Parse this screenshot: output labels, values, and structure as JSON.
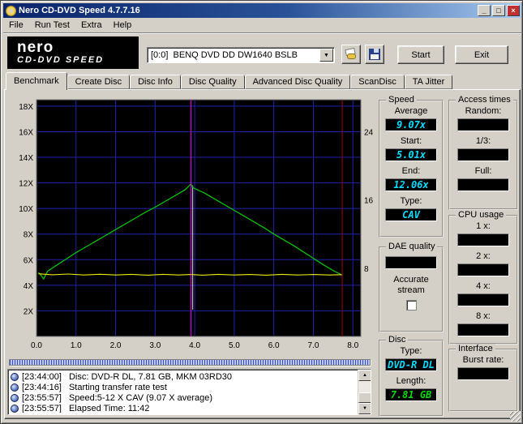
{
  "window": {
    "title": "Nero CD-DVD Speed 4.7.7.16",
    "menu": [
      "File",
      "Run Test",
      "Extra",
      "Help"
    ]
  },
  "icons": {
    "minimize": "_",
    "maximize": "□",
    "close": "×",
    "dropdown": "▼",
    "scroll_up": "▲",
    "scroll_down": "▼"
  },
  "toolbar": {
    "logo_brand": "nero",
    "logo_product": "CD-DVD SPEED",
    "drive_selector": "[0:0]  BENQ DVD DD DW1640 BSLB",
    "start_label": "Start",
    "exit_label": "Exit"
  },
  "tabs": [
    {
      "label": "Benchmark",
      "active": true
    },
    {
      "label": "Create Disc"
    },
    {
      "label": "Disc Info"
    },
    {
      "label": "Disc Quality"
    },
    {
      "label": "Advanced Disc Quality"
    },
    {
      "label": "ScanDisc"
    },
    {
      "label": "TA Jitter"
    }
  ],
  "chart_data": {
    "type": "line",
    "title": "",
    "xlabel": "",
    "ylabel": "",
    "xlim": [
      0,
      8.2
    ],
    "ylim": [
      0,
      18.5
    ],
    "x_ticks": [
      0,
      1,
      2,
      3,
      4,
      5,
      6,
      7,
      8
    ],
    "x_tick_labels": [
      "0.0",
      "1.0",
      "2.0",
      "3.0",
      "4.0",
      "5.0",
      "6.0",
      "7.0",
      "8.0"
    ],
    "y_ticks": [
      2,
      4,
      6,
      8,
      10,
      12,
      14,
      16,
      18
    ],
    "y_tick_labels": [
      "2X",
      "4X",
      "6X",
      "8X",
      "10X",
      "12X",
      "14X",
      "16X",
      "18X"
    ],
    "right_axis": {
      "ticks": [
        8,
        16,
        24
      ],
      "ratio": 1.5
    },
    "grid": true,
    "grid_color": "#2121a8",
    "plot_bg": "#000000",
    "series": [
      {
        "name": "read-speed",
        "color": "#00c000",
        "width": 1.3,
        "points": [
          [
            0.05,
            5.0
          ],
          [
            0.12,
            4.75
          ],
          [
            0.18,
            4.5
          ],
          [
            0.28,
            5.1
          ],
          [
            0.5,
            5.55
          ],
          [
            0.75,
            6.05
          ],
          [
            1.0,
            6.55
          ],
          [
            1.25,
            7.0
          ],
          [
            1.5,
            7.45
          ],
          [
            1.75,
            7.9
          ],
          [
            2.0,
            8.35
          ],
          [
            2.25,
            8.8
          ],
          [
            2.5,
            9.25
          ],
          [
            2.75,
            9.7
          ],
          [
            3.0,
            10.1
          ],
          [
            3.25,
            10.55
          ],
          [
            3.5,
            11.0
          ],
          [
            3.75,
            11.45
          ],
          [
            3.9,
            11.9
          ],
          [
            3.97,
            11.6
          ],
          [
            4.25,
            11.2
          ],
          [
            4.5,
            10.75
          ],
          [
            4.75,
            10.3
          ],
          [
            5.0,
            9.85
          ],
          [
            5.25,
            9.4
          ],
          [
            5.5,
            8.95
          ],
          [
            5.75,
            8.5
          ],
          [
            6.0,
            8.0
          ],
          [
            6.25,
            7.55
          ],
          [
            6.5,
            7.1
          ],
          [
            6.75,
            6.6
          ],
          [
            7.0,
            6.1
          ],
          [
            7.25,
            5.6
          ],
          [
            7.5,
            5.15
          ],
          [
            7.72,
            4.8
          ]
        ]
      },
      {
        "name": "rotation-speed",
        "color": "#e8e800",
        "width": 1.1,
        "points": [
          [
            0.05,
            4.9
          ],
          [
            0.4,
            4.82
          ],
          [
            0.8,
            4.88
          ],
          [
            1.2,
            4.8
          ],
          [
            1.6,
            4.86
          ],
          [
            2.0,
            4.8
          ],
          [
            2.4,
            4.85
          ],
          [
            2.8,
            4.79
          ],
          [
            3.2,
            4.85
          ],
          [
            3.6,
            4.8
          ],
          [
            3.9,
            4.84
          ],
          [
            4.2,
            4.79
          ],
          [
            4.6,
            4.85
          ],
          [
            5.0,
            4.8
          ],
          [
            5.4,
            4.84
          ],
          [
            5.8,
            4.79
          ],
          [
            6.2,
            4.85
          ],
          [
            6.6,
            4.8
          ],
          [
            7.0,
            4.84
          ],
          [
            7.4,
            4.8
          ],
          [
            7.72,
            4.83
          ]
        ]
      }
    ],
    "markers": [
      {
        "name": "layer-transition-flash",
        "x": 3.95,
        "color": "#e0e0e0",
        "y1": 2.1,
        "y2": 11.8,
        "under": true
      },
      {
        "name": "layer-break-line",
        "x": 3.91,
        "color": "#ff00ff"
      },
      {
        "name": "end-of-test-line",
        "x": 7.73,
        "color": "#a00000"
      }
    ]
  },
  "panels": {
    "speed": {
      "caption": "Speed",
      "items": [
        {
          "label": "Average",
          "value": "9.07x"
        },
        {
          "label": "Start:",
          "value": "5.01x"
        },
        {
          "label": "End:",
          "value": "12.06x"
        },
        {
          "label": "Type:",
          "value": "CAV"
        }
      ]
    },
    "access": {
      "caption": "Access times",
      "items": [
        {
          "label": "Random:",
          "value": ""
        },
        {
          "label": "1/3:",
          "value": ""
        },
        {
          "label": "Full:",
          "value": ""
        }
      ]
    },
    "cpu": {
      "caption": "CPU usage",
      "items": [
        {
          "label": "1 x:",
          "value": ""
        },
        {
          "label": "2 x:",
          "value": ""
        },
        {
          "label": "4 x:",
          "value": ""
        },
        {
          "label": "8 x:",
          "value": ""
        }
      ]
    },
    "dae": {
      "caption": "DAE quality",
      "value": "",
      "accurate_label": "Accurate stream",
      "checked": false
    },
    "disc": {
      "caption": "Disc",
      "items": [
        {
          "label": "Type:",
          "value": "DVD-R DL",
          "value_color": "#00dcff"
        },
        {
          "label": "Length:",
          "value": "7.81 GB",
          "value_color": "#00d800"
        }
      ]
    },
    "interface": {
      "caption": "Interface",
      "items": [
        {
          "label": "Burst rate:",
          "value": ""
        }
      ]
    }
  },
  "log": {
    "lines": [
      {
        "time": "[23:44:00]",
        "text": "Disc: DVD-R DL, 7.81 GB, MKM 03RD30"
      },
      {
        "time": "[23:44:16]",
        "text": "Starting transfer rate test"
      },
      {
        "time": "[23:55:57]",
        "text": "Speed:5-12 X CAV (9.07 X average)"
      },
      {
        "time": "[23:55:57]",
        "text": "Elapsed Time: 11:42"
      }
    ]
  },
  "colors": {
    "accent_cyan": "#00dcff",
    "accent_green": "#00d800",
    "title_grad_start": "#0a246a",
    "title_grad_end": "#a6caf0"
  }
}
